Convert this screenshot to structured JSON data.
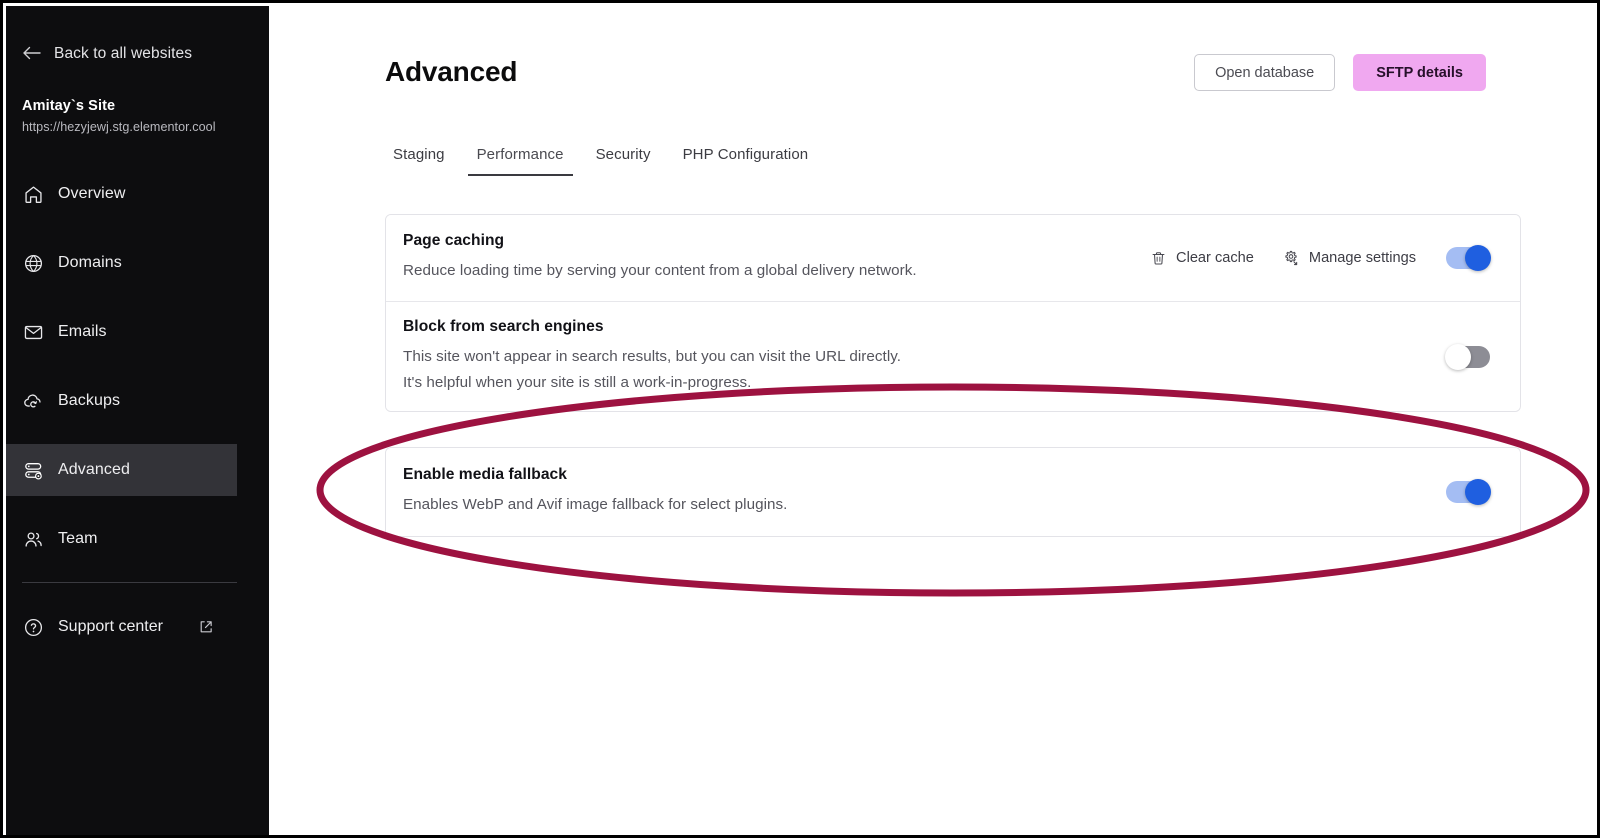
{
  "sidebar": {
    "back_label": "Back to all websites",
    "back_icon": "arrow-left-icon",
    "site_name": "Amitay`s Site",
    "site_url": "https://hezyjewj.stg.elementor.cool",
    "items": [
      {
        "label": "Overview",
        "icon": "home-icon",
        "active": false
      },
      {
        "label": "Domains",
        "icon": "globe-icon",
        "active": false
      },
      {
        "label": "Emails",
        "icon": "envelope-icon",
        "active": false
      },
      {
        "label": "Backups",
        "icon": "cloud-refresh-icon",
        "active": false
      },
      {
        "label": "Advanced",
        "icon": "server-settings-icon",
        "active": true
      },
      {
        "label": "Team",
        "icon": "users-icon",
        "active": false
      }
    ],
    "support": {
      "label": "Support center",
      "icon": "question-circle-icon",
      "external_icon": "external-link-icon"
    },
    "active_bg": "#333338",
    "bg": "#0d0d0f"
  },
  "header": {
    "title": "Advanced",
    "open_database_label": "Open database",
    "sftp_details_label": "SFTP details",
    "sftp_button_color": "#f0a8f0"
  },
  "tabs": [
    {
      "label": "Staging",
      "active": false
    },
    {
      "label": "Performance",
      "active": true
    },
    {
      "label": "Security",
      "active": false
    },
    {
      "label": "PHP Configuration",
      "active": false
    }
  ],
  "settings": {
    "group": [
      {
        "title": "Page caching",
        "description": "Reduce loading time by serving your content from a global delivery network.",
        "actions": [
          {
            "label": "Clear cache",
            "icon": "trash-icon"
          },
          {
            "label": "Manage settings",
            "icon": "gear-arrow-icon"
          }
        ],
        "toggle": "on"
      },
      {
        "title": "Block from search engines",
        "description": "This site won't appear in search results, but you can visit the URL directly.\nIt's helpful when your site is still a work-in-progress.",
        "description_line1": "This site won't appear in search results, but you can visit the URL directly.",
        "description_line2": "It's helpful when your site is still a work-in-progress.",
        "actions": [],
        "toggle": "off"
      }
    ],
    "standalone": {
      "title": "Enable media fallback",
      "description": "Enables WebP and Avif image fallback for select plugins.",
      "toggle": "on"
    },
    "toggle_on_color": "#1f5fe0",
    "toggle_off_color": "#8d8d95"
  },
  "annotation": {
    "shape": "ellipse-highlight",
    "color": "#9d1240",
    "target": "Enable media fallback"
  }
}
